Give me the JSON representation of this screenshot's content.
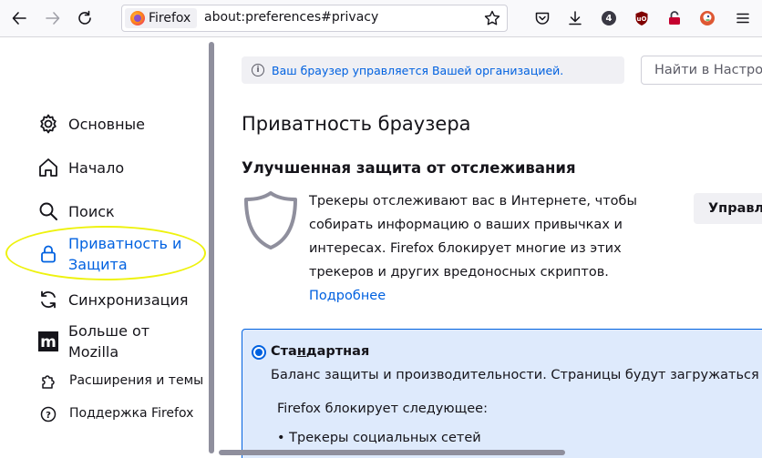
{
  "toolbar": {
    "identity_label": "Firefox",
    "url": "about:preferences#privacy",
    "extension_badge": "4"
  },
  "sidebar": {
    "items": [
      {
        "label": "Основные",
        "icon": "gear-icon"
      },
      {
        "label": "Начало",
        "icon": "home-icon"
      },
      {
        "label": "Поиск",
        "icon": "search-icon"
      },
      {
        "label": "Приватность и Защита",
        "icon": "lock-icon",
        "selected": true
      },
      {
        "label": "Синхронизация",
        "icon": "sync-icon"
      },
      {
        "label": "Больше от Mozilla",
        "icon": "mozilla-icon"
      },
      {
        "label": "Расширения и темы",
        "icon": "puzzle-icon"
      },
      {
        "label": "Поддержка Firefox",
        "icon": "help-icon"
      }
    ]
  },
  "main": {
    "policy_notice": "Ваш браузер управляется Вашей организацией.",
    "search_placeholder": "Найти в Настройках",
    "page_title": "Приватность браузера",
    "etp_heading": "Улучшенная защита от отслеживания",
    "etp_description": "Трекеры отслеживают вас в Интернете, чтобы собирать информацию о ваших привычках и интересах. Firefox блокирует многие из этих трекеров и других вредоносных скриптов.",
    "learn_more": "Подробнее",
    "manage_button": "Управлять исключениями…",
    "standard": {
      "title_pre": "Ста",
      "title_accel": "н",
      "title_post": "дартная",
      "subtitle": "Баланс защиты и производительности. Страницы будут загружаться нормально.",
      "blocks_label": "Firefox блокирует следующее:",
      "first_item": "• Трекеры социальных сетей"
    }
  },
  "colors": {
    "accent": "#0061e0",
    "highlight": "#eef20e",
    "standard_bg": "#deeafc"
  }
}
